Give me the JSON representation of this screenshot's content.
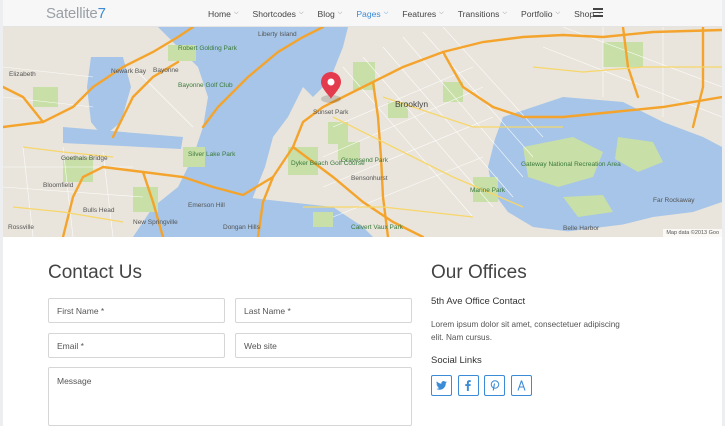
{
  "header": {
    "logo_text": "Satellite",
    "logo_num": "7",
    "nav": [
      {
        "label": "Home",
        "active": false
      },
      {
        "label": "Shortcodes",
        "active": false
      },
      {
        "label": "Blog",
        "active": false
      },
      {
        "label": "Pages",
        "active": true
      },
      {
        "label": "Features",
        "active": false
      },
      {
        "label": "Transitions",
        "active": false
      },
      {
        "label": "Portfolio",
        "active": false
      },
      {
        "label": "Shop",
        "active": false
      }
    ]
  },
  "map": {
    "credit": "Map data ©2013 Goo",
    "labels": {
      "elizabeth": "Elizabeth",
      "newark_bay": "Newark Bay",
      "bayonne": "Bayonne",
      "bayonne_golf": "Bayonne Golf Club",
      "liberty": "Liberty Island",
      "robert": "Robert Golding Park",
      "brooklyn": "Brooklyn",
      "sunset": "Sunset Park",
      "dyker": "Dyker Beach Golf Course",
      "gravesend": "Gravesend Park",
      "marine": "Marine Park",
      "gateway": "Gateway National Recreation Area",
      "bensonhurst": "Bensonhurst",
      "calvert": "Calvert Vaux Park",
      "goethals": "Goethals Bridge",
      "bloomfield": "Bloomfield",
      "bulls_head": "Bulls Head",
      "silver_lake": "Silver Lake Park",
      "new_springville": "New Springville",
      "emerson": "Emerson Hill",
      "dongan": "Dongan Hills",
      "rossville": "Rossville",
      "far_rockaway": "Far Rockaway",
      "belle_harbor": "Belle Harbor"
    }
  },
  "contact": {
    "title": "Contact Us",
    "first_name_placeholder": "First Name *",
    "last_name_placeholder": "Last Name *",
    "email_placeholder": "Email *",
    "website_placeholder": "Web site",
    "message_placeholder": "Message"
  },
  "offices": {
    "title": "Our Offices",
    "subtitle": "5th Ave Office Contact",
    "text": "Lorem ipsum dolor sit amet, consectetuer adipiscing elit. Nam cursus.",
    "social_title": "Social Links",
    "social": [
      {
        "name": "twitter-icon"
      },
      {
        "name": "facebook-icon"
      },
      {
        "name": "pinterest-icon"
      },
      {
        "name": "app-icon"
      }
    ]
  },
  "colors": {
    "accent": "#3b8bd6",
    "water": "#a6c5e8",
    "park": "#c8dfa8",
    "highway": "#f4a42c",
    "pin": "#e33a4e"
  }
}
